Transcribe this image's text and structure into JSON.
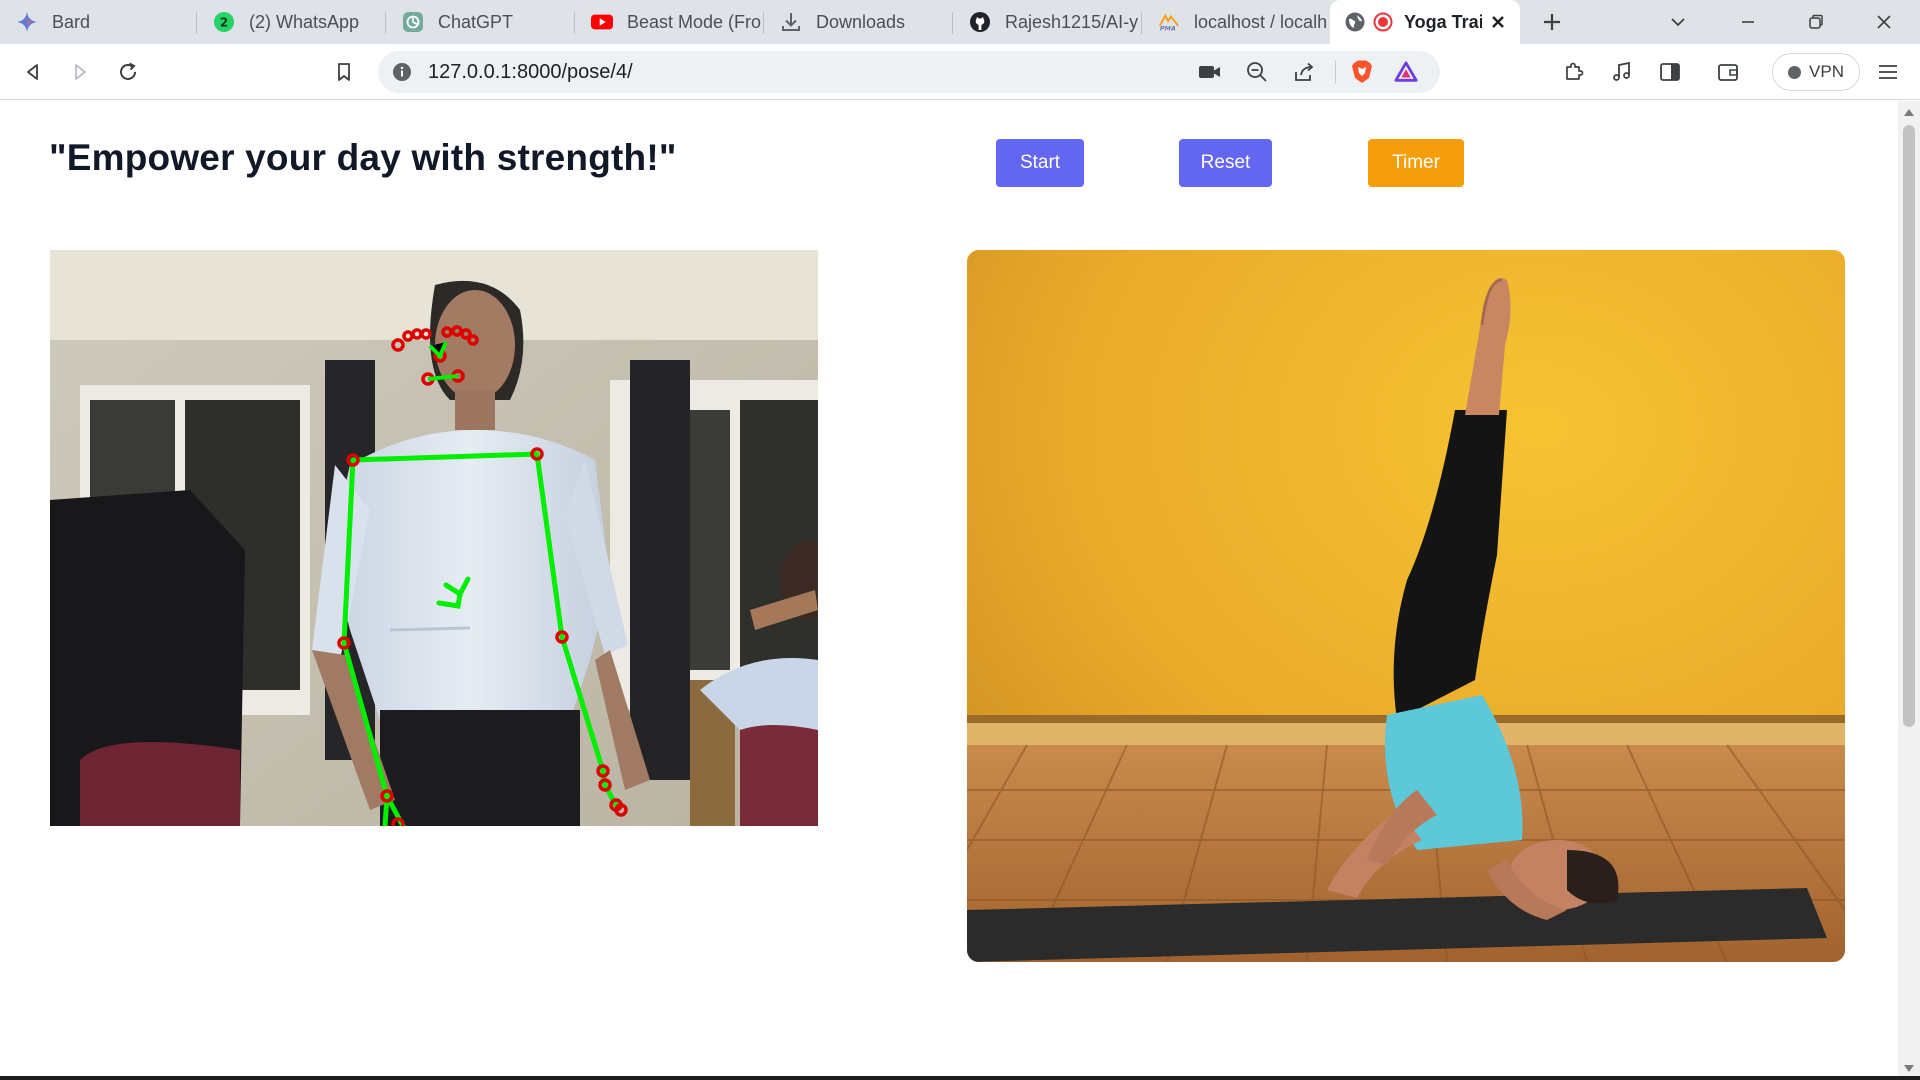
{
  "browser": {
    "tabs": [
      {
        "label": "Bard",
        "icon": "bard-sparkle-icon"
      },
      {
        "label": "(2) WhatsApp",
        "icon": "whatsapp-icon",
        "badge": "2"
      },
      {
        "label": "ChatGPT",
        "icon": "chatgpt-icon"
      },
      {
        "label": "Beast Mode (Fro",
        "icon": "youtube-icon"
      },
      {
        "label": "Downloads",
        "icon": "download-icon"
      },
      {
        "label": "Rajesh1215/AI-y",
        "icon": "github-icon"
      },
      {
        "label": "localhost / localh",
        "icon": "phpmyadmin-icon"
      },
      {
        "label": "Yoga Trai",
        "icon": "globe-icon",
        "active": true,
        "recording": true
      }
    ],
    "url": "127.0.0.1:8000/pose/4/",
    "vpn_label": "VPN"
  },
  "page": {
    "quote": "\"Empower your day with strength!\"",
    "buttons": {
      "start": "Start",
      "reset": "Reset",
      "timer": "Timer"
    }
  },
  "colors": {
    "primary_button": "#6366f1",
    "timer_button": "#f59e0b",
    "skeleton_line": "#00ff00",
    "skeleton_joint": "#ff0000"
  }
}
